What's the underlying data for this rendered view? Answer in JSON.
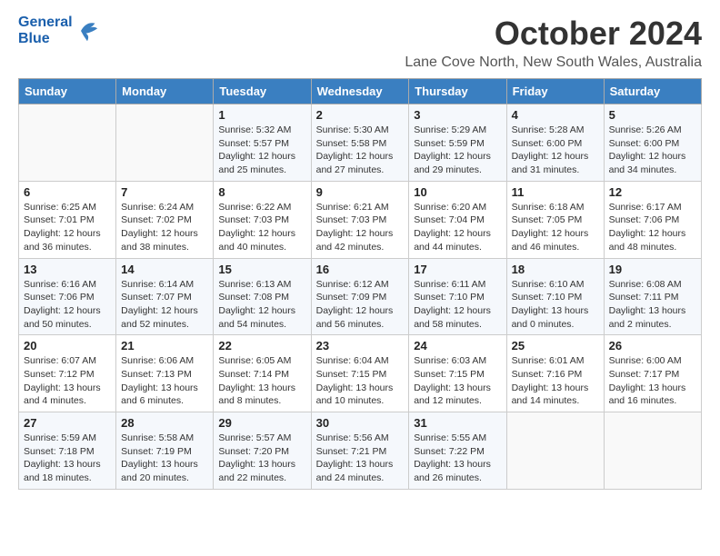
{
  "logo": {
    "general": "General",
    "blue": "Blue"
  },
  "title": "October 2024",
  "location": "Lane Cove North, New South Wales, Australia",
  "days_header": [
    "Sunday",
    "Monday",
    "Tuesday",
    "Wednesday",
    "Thursday",
    "Friday",
    "Saturday"
  ],
  "weeks": [
    [
      {
        "day": "",
        "info": ""
      },
      {
        "day": "",
        "info": ""
      },
      {
        "day": "1",
        "info": "Sunrise: 5:32 AM\nSunset: 5:57 PM\nDaylight: 12 hours\nand 25 minutes."
      },
      {
        "day": "2",
        "info": "Sunrise: 5:30 AM\nSunset: 5:58 PM\nDaylight: 12 hours\nand 27 minutes."
      },
      {
        "day": "3",
        "info": "Sunrise: 5:29 AM\nSunset: 5:59 PM\nDaylight: 12 hours\nand 29 minutes."
      },
      {
        "day": "4",
        "info": "Sunrise: 5:28 AM\nSunset: 6:00 PM\nDaylight: 12 hours\nand 31 minutes."
      },
      {
        "day": "5",
        "info": "Sunrise: 5:26 AM\nSunset: 6:00 PM\nDaylight: 12 hours\nand 34 minutes."
      }
    ],
    [
      {
        "day": "6",
        "info": "Sunrise: 6:25 AM\nSunset: 7:01 PM\nDaylight: 12 hours\nand 36 minutes."
      },
      {
        "day": "7",
        "info": "Sunrise: 6:24 AM\nSunset: 7:02 PM\nDaylight: 12 hours\nand 38 minutes."
      },
      {
        "day": "8",
        "info": "Sunrise: 6:22 AM\nSunset: 7:03 PM\nDaylight: 12 hours\nand 40 minutes."
      },
      {
        "day": "9",
        "info": "Sunrise: 6:21 AM\nSunset: 7:03 PM\nDaylight: 12 hours\nand 42 minutes."
      },
      {
        "day": "10",
        "info": "Sunrise: 6:20 AM\nSunset: 7:04 PM\nDaylight: 12 hours\nand 44 minutes."
      },
      {
        "day": "11",
        "info": "Sunrise: 6:18 AM\nSunset: 7:05 PM\nDaylight: 12 hours\nand 46 minutes."
      },
      {
        "day": "12",
        "info": "Sunrise: 6:17 AM\nSunset: 7:06 PM\nDaylight: 12 hours\nand 48 minutes."
      }
    ],
    [
      {
        "day": "13",
        "info": "Sunrise: 6:16 AM\nSunset: 7:06 PM\nDaylight: 12 hours\nand 50 minutes."
      },
      {
        "day": "14",
        "info": "Sunrise: 6:14 AM\nSunset: 7:07 PM\nDaylight: 12 hours\nand 52 minutes."
      },
      {
        "day": "15",
        "info": "Sunrise: 6:13 AM\nSunset: 7:08 PM\nDaylight: 12 hours\nand 54 minutes."
      },
      {
        "day": "16",
        "info": "Sunrise: 6:12 AM\nSunset: 7:09 PM\nDaylight: 12 hours\nand 56 minutes."
      },
      {
        "day": "17",
        "info": "Sunrise: 6:11 AM\nSunset: 7:10 PM\nDaylight: 12 hours\nand 58 minutes."
      },
      {
        "day": "18",
        "info": "Sunrise: 6:10 AM\nSunset: 7:10 PM\nDaylight: 13 hours\nand 0 minutes."
      },
      {
        "day": "19",
        "info": "Sunrise: 6:08 AM\nSunset: 7:11 PM\nDaylight: 13 hours\nand 2 minutes."
      }
    ],
    [
      {
        "day": "20",
        "info": "Sunrise: 6:07 AM\nSunset: 7:12 PM\nDaylight: 13 hours\nand 4 minutes."
      },
      {
        "day": "21",
        "info": "Sunrise: 6:06 AM\nSunset: 7:13 PM\nDaylight: 13 hours\nand 6 minutes."
      },
      {
        "day": "22",
        "info": "Sunrise: 6:05 AM\nSunset: 7:14 PM\nDaylight: 13 hours\nand 8 minutes."
      },
      {
        "day": "23",
        "info": "Sunrise: 6:04 AM\nSunset: 7:15 PM\nDaylight: 13 hours\nand 10 minutes."
      },
      {
        "day": "24",
        "info": "Sunrise: 6:03 AM\nSunset: 7:15 PM\nDaylight: 13 hours\nand 12 minutes."
      },
      {
        "day": "25",
        "info": "Sunrise: 6:01 AM\nSunset: 7:16 PM\nDaylight: 13 hours\nand 14 minutes."
      },
      {
        "day": "26",
        "info": "Sunrise: 6:00 AM\nSunset: 7:17 PM\nDaylight: 13 hours\nand 16 minutes."
      }
    ],
    [
      {
        "day": "27",
        "info": "Sunrise: 5:59 AM\nSunset: 7:18 PM\nDaylight: 13 hours\nand 18 minutes."
      },
      {
        "day": "28",
        "info": "Sunrise: 5:58 AM\nSunset: 7:19 PM\nDaylight: 13 hours\nand 20 minutes."
      },
      {
        "day": "29",
        "info": "Sunrise: 5:57 AM\nSunset: 7:20 PM\nDaylight: 13 hours\nand 22 minutes."
      },
      {
        "day": "30",
        "info": "Sunrise: 5:56 AM\nSunset: 7:21 PM\nDaylight: 13 hours\nand 24 minutes."
      },
      {
        "day": "31",
        "info": "Sunrise: 5:55 AM\nSunset: 7:22 PM\nDaylight: 13 hours\nand 26 minutes."
      },
      {
        "day": "",
        "info": ""
      },
      {
        "day": "",
        "info": ""
      }
    ]
  ]
}
